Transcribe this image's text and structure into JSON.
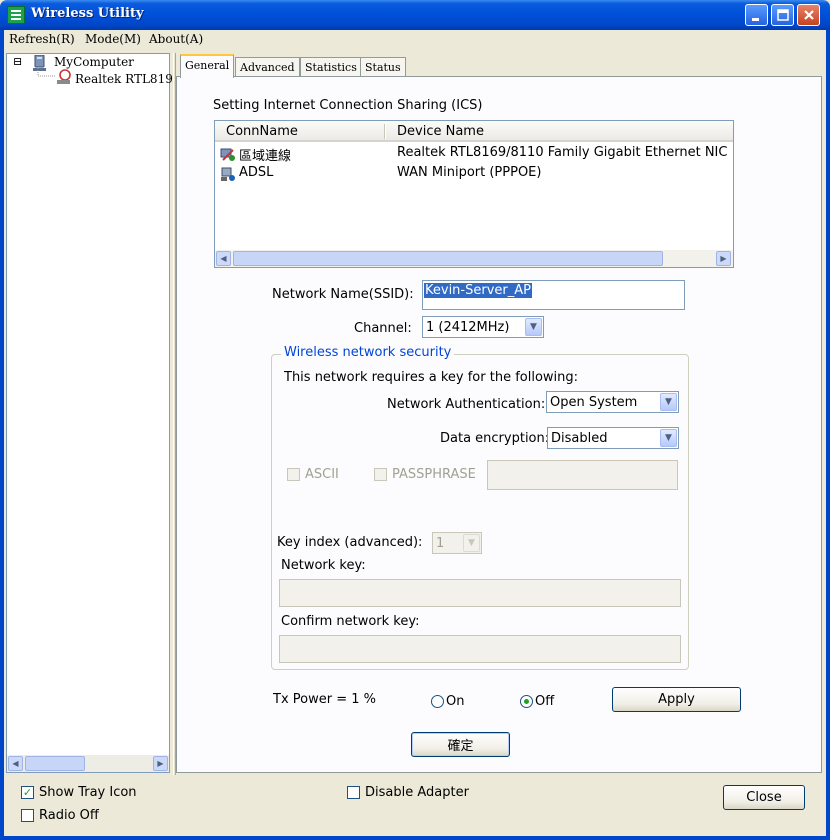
{
  "window": {
    "title": "Wireless Utility"
  },
  "menu": {
    "items": [
      "Refresh(R)",
      "Mode(M)",
      "About(A)"
    ]
  },
  "tree": {
    "expander": "⊟",
    "root": "MyComputer",
    "child": "Realtek RTL819"
  },
  "tabs": [
    "General",
    "Advanced",
    "Statistics",
    "Status"
  ],
  "ics": {
    "title": "Setting Internet Connection Sharing (ICS)",
    "columns": [
      "ConnName",
      "Device Name"
    ],
    "rows": [
      {
        "name": "區域連線",
        "device": "Realtek RTL8169/8110 Family Gigabit Ethernet NIC"
      },
      {
        "name": "ADSL",
        "device": "WAN Miniport (PPPOE)"
      }
    ]
  },
  "network": {
    "ssid_label": "Network Name(SSID):",
    "ssid_value": "Kevin-Server_AP",
    "channel_label": "Channel:",
    "channel_value": "1  (2412MHz)"
  },
  "security": {
    "group_title": "Wireless network security",
    "requires_text": "This network requires a key for the following:",
    "auth_label": "Network Authentication:",
    "auth_value": "Open System",
    "enc_label": "Data encryption:",
    "enc_value": "Disabled",
    "ascii_label": "ASCII",
    "passphrase_label": "PASSPHRASE",
    "key_index_label": "Key index (advanced):",
    "key_index_value": "1",
    "network_key_label": "Network key:",
    "confirm_key_label": "Confirm network key:"
  },
  "power": {
    "label": "Tx Power =  1 %",
    "on_label": "On",
    "off_label": "Off",
    "apply_label": "Apply"
  },
  "ok_label": "確定",
  "bottom": {
    "show_tray_label": "Show Tray Icon",
    "radio_off_label": "Radio Off",
    "disable_adapter_label": "Disable Adapter",
    "close_label": "Close"
  },
  "icons": {
    "minimize": "minimize-icon",
    "maximize": "maximize-icon",
    "close": "close-icon",
    "computer": "computer-icon",
    "wireless_adapter": "wireless-adapter-icon",
    "lan": "lan-connection-icon",
    "dialup": "dialup-connection-icon",
    "check": "check-icon"
  },
  "state": {
    "show_tray_checked": true,
    "radio_off_checked": false,
    "disable_adapter_checked": false,
    "power_on_selected": false,
    "power_off_selected": true
  },
  "colors": {
    "titlebar": "#0050d8",
    "window_bg": "#ece9d8",
    "group_title": "#0046d5",
    "selection": "#316ac5",
    "active_tab_accent": "#ffc83c"
  }
}
